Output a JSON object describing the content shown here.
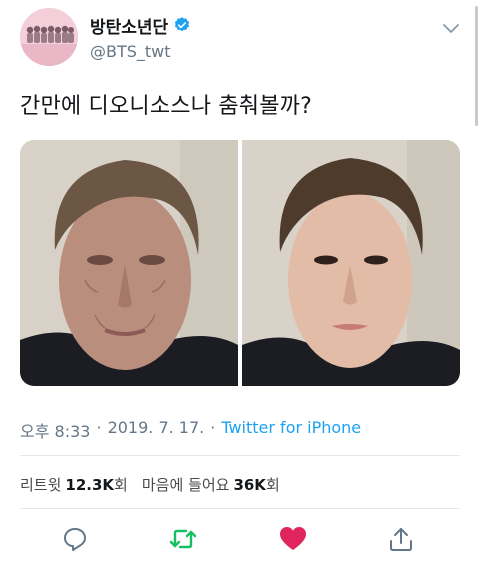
{
  "user": {
    "display_name": "방탄소년단",
    "handle": "@BTS_twt",
    "verified": true
  },
  "tweet": {
    "text": "간만에 디오니소스나 춤춰볼까?"
  },
  "meta": {
    "time": "오후 8:33",
    "date": "2019. 7. 17.",
    "separator_1": "·",
    "separator_2": "·",
    "source": "Twitter for iPhone"
  },
  "stats": {
    "retweet_label": "리트윗",
    "retweet_count": "12.3K",
    "retweet_suffix": "회",
    "like_label": "마음에 들어요",
    "like_count": "36K",
    "like_suffix": "회"
  },
  "colors": {
    "accent": "#1da1f2",
    "retweet_green": "#17bf63",
    "like_red": "#e0245e",
    "muted": "#657786"
  },
  "icons": {
    "reply": "reply-icon",
    "retweet": "retweet-icon",
    "like": "heart-icon",
    "share": "share-icon",
    "verified": "verified-badge-icon",
    "menu": "chevron-down-icon"
  }
}
